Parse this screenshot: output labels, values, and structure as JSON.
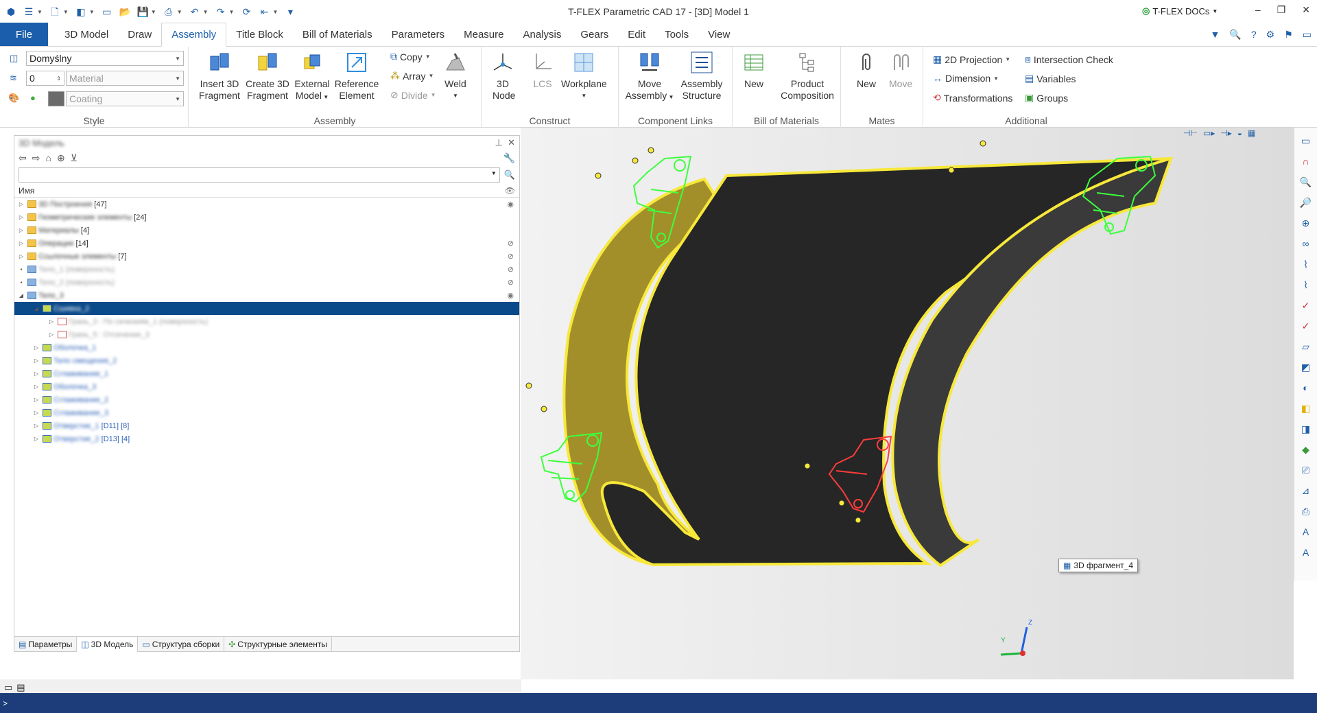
{
  "window": {
    "title": "T-FLEX Parametric CAD 17 - [3D] Model 1",
    "docs_label": "T-FLEX DOCs",
    "min": "–",
    "restore": "❐",
    "close": "✕"
  },
  "menu": {
    "file": "File",
    "tabs": [
      "3D Model",
      "Draw",
      "Assembly",
      "Title Block",
      "Bill of Materials",
      "Parameters",
      "Measure",
      "Analysis",
      "Gears",
      "Edit",
      "Tools",
      "View"
    ],
    "active_tab": "Assembly"
  },
  "ribbon": {
    "style": {
      "title": "Style",
      "layer_value": "Domyślny",
      "level_value": "0",
      "material_placeholder": "Material",
      "coating_placeholder": "Coating"
    },
    "assembly": {
      "title": "Assembly",
      "insert_fragment": "Insert 3D Fragment",
      "create_fragment": "Create 3D Fragment",
      "external_model": "External Model",
      "reference_element": "Reference Element",
      "copy": "Copy",
      "array": "Array",
      "divide": "Divide",
      "weld": "Weld"
    },
    "construct": {
      "title": "Construct",
      "node": "3D Node",
      "lcs": "LCS",
      "workplane": "Workplane"
    },
    "component_links": {
      "title": "Component Links",
      "move_assembly": "Move Assembly",
      "assembly_structure": "Assembly Structure"
    },
    "bom": {
      "title": "Bill of Materials",
      "new": "New",
      "product_composition": "Product Composition"
    },
    "mates": {
      "title": "Mates",
      "new": "New",
      "move": "Move"
    },
    "additional": {
      "title": "Additional",
      "projection": "2D Projection",
      "dimension": "Dimension",
      "transformations": "Transformations",
      "intersection": "Intersection Check",
      "variables": "Variables",
      "groups": "Groups"
    }
  },
  "panel": {
    "title": "3D Модель",
    "column_name": "Имя",
    "tree": [
      {
        "label": "3D Построения",
        "count": "[47]",
        "level": 0,
        "icon": "folder",
        "state": "collapsed",
        "eye": "visible"
      },
      {
        "label": "Геометрические элементы",
        "count": "[24]",
        "level": 0,
        "icon": "folder",
        "state": "collapsed",
        "eye": ""
      },
      {
        "label": "Материалы",
        "count": "[4]",
        "level": 0,
        "icon": "folder",
        "state": "collapsed",
        "eye": ""
      },
      {
        "label": "Операции",
        "count": "[14]",
        "level": 0,
        "icon": "folder",
        "state": "collapsed",
        "eye": "hidden"
      },
      {
        "label": "Ссылочные элементы",
        "count": "[7]",
        "level": 0,
        "icon": "folder",
        "state": "collapsed",
        "eye": "hidden"
      },
      {
        "label": "Тело_1 (поверхность)",
        "count": "",
        "level": 0,
        "icon": "body",
        "state": "leaf",
        "eye": "hidden"
      },
      {
        "label": "Тело_2 (поверхность)",
        "count": "",
        "level": 0,
        "icon": "body",
        "state": "leaf",
        "eye": "hidden"
      },
      {
        "label": "Тело_3",
        "count": "",
        "level": 0,
        "icon": "body",
        "state": "expanded",
        "eye": "visible"
      },
      {
        "label": "Сшивка_2",
        "count": "",
        "level": 1,
        "icon": "op",
        "state": "expanded",
        "eye": "",
        "selected": true
      },
      {
        "label": "Грань_3 : По сечениям_1 (поверхность)",
        "count": "",
        "level": 2,
        "icon": "face",
        "state": "collapsed",
        "eye": ""
      },
      {
        "label": "Грань_5 : Отсечение_3",
        "count": "",
        "level": 2,
        "icon": "face",
        "state": "collapsed",
        "eye": ""
      },
      {
        "label": "Оболочка_1",
        "count": "",
        "level": 1,
        "icon": "op",
        "state": "collapsed",
        "eye": ""
      },
      {
        "label": "Тело смещения_2",
        "count": "",
        "level": 1,
        "icon": "op",
        "state": "collapsed",
        "eye": ""
      },
      {
        "label": "Сглаживание_1",
        "count": "",
        "level": 1,
        "icon": "op",
        "state": "collapsed",
        "eye": ""
      },
      {
        "label": "Оболочка_3",
        "count": "",
        "level": 1,
        "icon": "op",
        "state": "collapsed",
        "eye": ""
      },
      {
        "label": "Сглаживание_2",
        "count": "",
        "level": 1,
        "icon": "op",
        "state": "collapsed",
        "eye": ""
      },
      {
        "label": "Сглаживание_3",
        "count": "",
        "level": 1,
        "icon": "op",
        "state": "collapsed",
        "eye": ""
      },
      {
        "label": "Отверстие_1",
        "count": "[D11] [8]",
        "level": 1,
        "icon": "op",
        "state": "collapsed",
        "eye": ""
      },
      {
        "label": "Отверстие_2",
        "count": "[D13] [4]",
        "level": 1,
        "icon": "op",
        "state": "collapsed",
        "eye": ""
      }
    ],
    "bottom_tabs": [
      "Параметры",
      "3D Модель",
      "Структура сборки",
      "Структурные элементы"
    ],
    "active_bottom_tab": "3D Модель"
  },
  "viewport": {
    "tooltip": "3D фрагмент_4",
    "axis_y": "Y",
    "axis_z": "Z",
    "panel_color": "#f7e83a",
    "body_color": "#2b2b2b",
    "fragment_color": "#3dff3d",
    "selected_fragment_color": "#ff3c3c"
  },
  "statusbar": {
    "text": ">"
  }
}
